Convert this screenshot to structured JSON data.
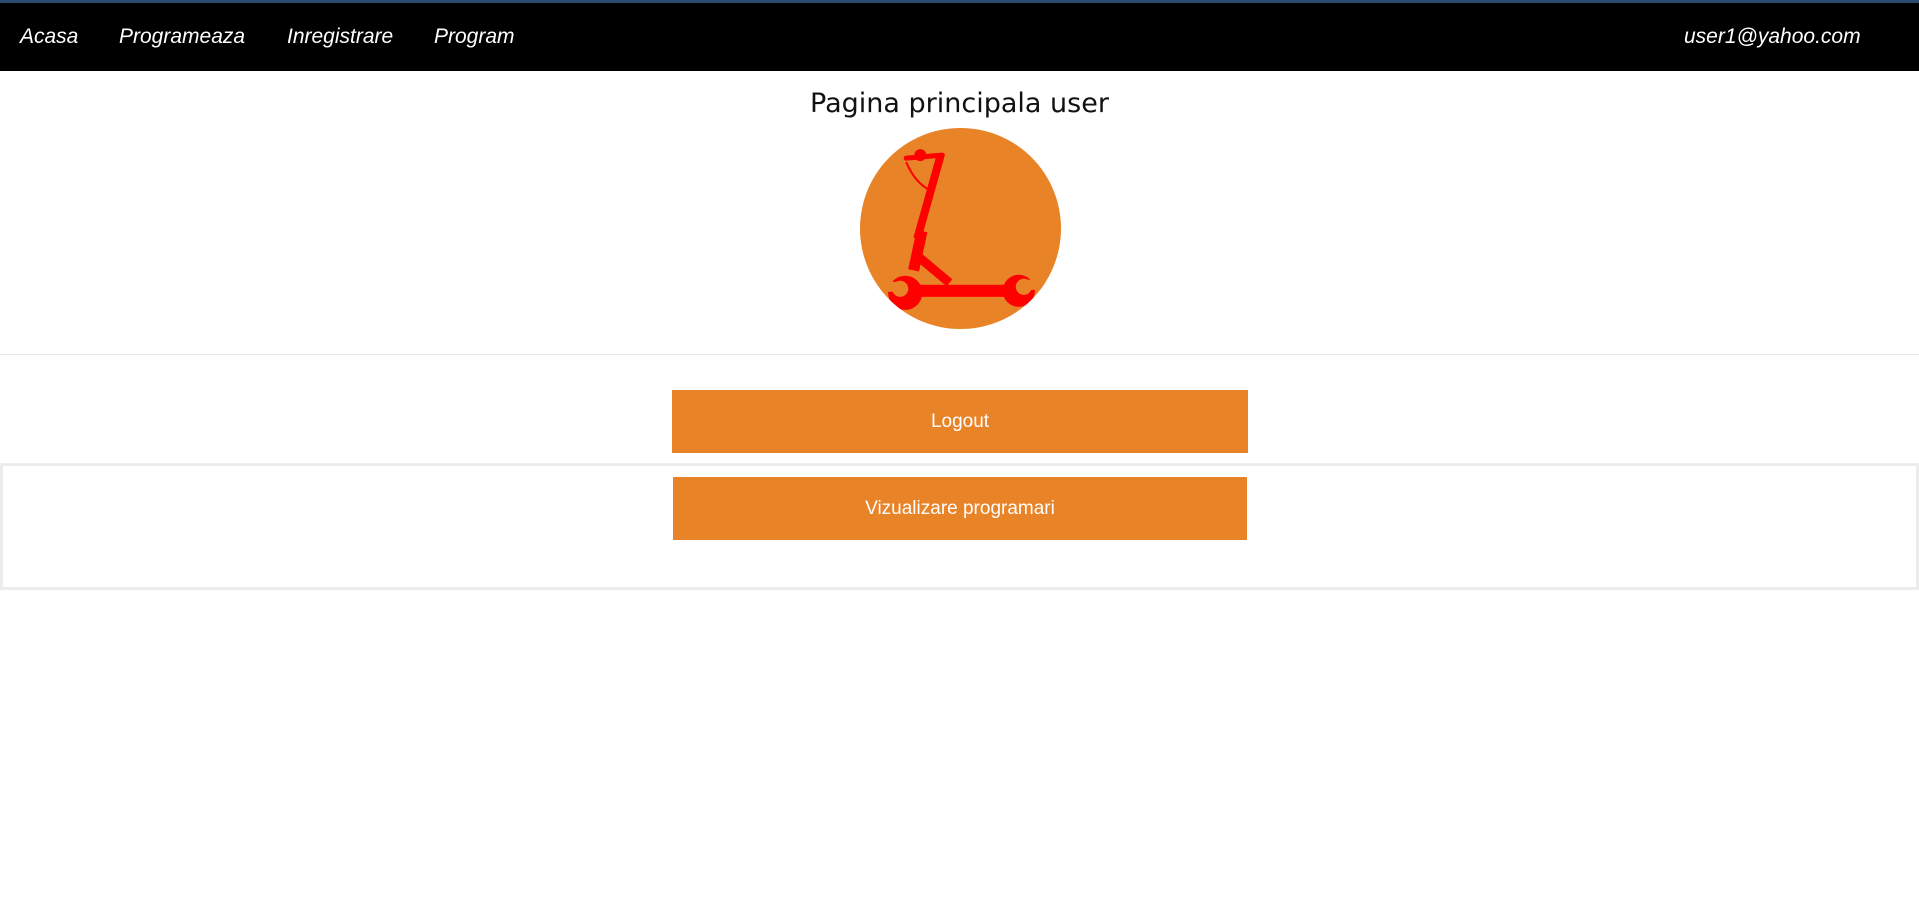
{
  "nav": {
    "links": [
      "Acasa",
      "Programeaza",
      "Inregistrare",
      "Program"
    ],
    "user_email": "user1@yahoo.com"
  },
  "page": {
    "title": "Pagina principala user"
  },
  "logo": {
    "icon": "scooter-wrench-icon",
    "circle_color": "#e88327",
    "icon_color": "#ff0000"
  },
  "actions": {
    "logout_label": "Logout",
    "view_appointments_label": "Vizualizare programari"
  },
  "colors": {
    "navbar": "#000000",
    "accent": "#e88327"
  }
}
